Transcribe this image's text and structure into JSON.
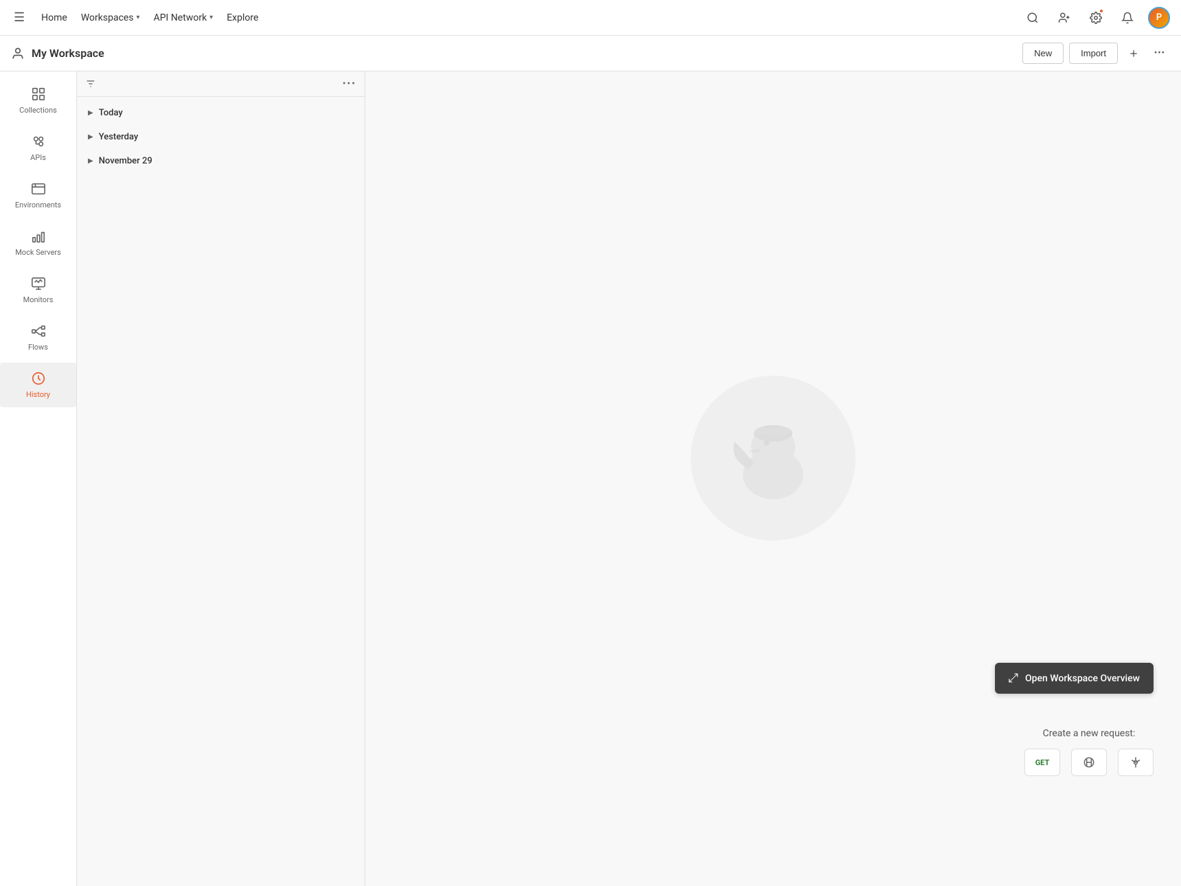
{
  "topNav": {
    "home": "Home",
    "workspaces": "Workspaces",
    "apiNetwork": "API Network",
    "explore": "Explore",
    "searchPlaceholder": "Search"
  },
  "workspace": {
    "icon": "👤",
    "title": "My Workspace",
    "newLabel": "New",
    "importLabel": "Import"
  },
  "sidebar": {
    "items": [
      {
        "id": "collections",
        "label": "Collections",
        "icon": "📋"
      },
      {
        "id": "apis",
        "label": "APIs",
        "icon": "⚙"
      },
      {
        "id": "environments",
        "label": "Environments",
        "icon": "🖥"
      },
      {
        "id": "mock-servers",
        "label": "Mock Servers",
        "icon": "📊"
      },
      {
        "id": "monitors",
        "label": "Monitors",
        "icon": "📈"
      },
      {
        "id": "flows",
        "label": "Flows",
        "icon": "🔀"
      },
      {
        "id": "history",
        "label": "History",
        "icon": "🕐"
      }
    ]
  },
  "history": {
    "groups": [
      {
        "id": "today",
        "label": "Today"
      },
      {
        "id": "yesterday",
        "label": "Yesterday"
      },
      {
        "id": "november29",
        "label": "November 29"
      }
    ]
  },
  "mainArea": {
    "openWorkspaceLabel": "Open Workspace Overview",
    "createRequestLabel": "Create a new request:",
    "requestTypes": [
      {
        "label": "GET",
        "type": "get"
      },
      {
        "label": "☁",
        "type": "graphql"
      },
      {
        "label": "↩",
        "type": "grpc"
      }
    ]
  }
}
